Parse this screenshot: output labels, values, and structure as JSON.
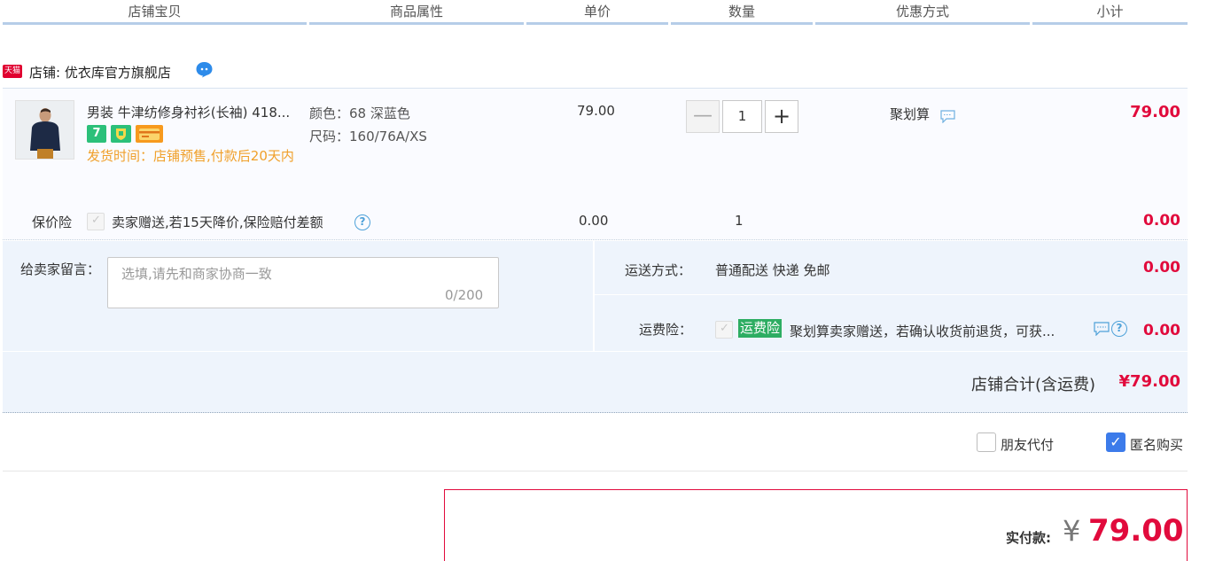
{
  "header": {
    "cols": [
      "店铺宝贝",
      "商品属性",
      "单价",
      "数量",
      "优惠方式",
      "小计"
    ]
  },
  "shop": {
    "badge": "天猫",
    "name": "店铺: 优衣库官方旗舰店"
  },
  "item": {
    "title": "男装 牛津纺修身衬衫(长袖) 418...",
    "icon_seven": "7",
    "ship_time": "发货时间：店铺预售,付款后20天内",
    "color": "颜色：68 深蓝色",
    "size": "尺码：160/76A/XS",
    "price": "79.00",
    "qty_minus": "—",
    "qty": "1",
    "qty_plus": "+",
    "promo": "聚划算",
    "subtotal": "79.00"
  },
  "insurance": {
    "label": "保价险",
    "text": "卖家赠送,若15天降价,保险赔付差额",
    "help": "?",
    "price": "0.00",
    "qty": "1",
    "subtotal": "0.00"
  },
  "message": {
    "label": "给卖家留言：",
    "placeholder": "选填,请先和商家协商一致",
    "count": "0/200"
  },
  "shipping": {
    "label": "运送方式：",
    "value": "普通配送 快递 免邮",
    "price": "0.00"
  },
  "freight_insurance": {
    "label": "运费险：",
    "badge": "运费险",
    "text": "聚划算卖家赠送，若确认收货前退货，可获...",
    "help": "?",
    "price": "0.00"
  },
  "shop_total": {
    "label": "店铺合计(含运费)",
    "value": "¥79.00"
  },
  "options": {
    "friend_pay": "朋友代付",
    "anonymous": "匿名购买"
  },
  "payment": {
    "label": "实付款:",
    "currency": "¥",
    "amount": "79.00"
  },
  "colors": {
    "accent_red": "#e10a3c",
    "ship_orange": "#f0a02a",
    "header_line": "#b6cde8",
    "panel_bg": "#eef4fc",
    "check_blue": "#3c7bea"
  }
}
